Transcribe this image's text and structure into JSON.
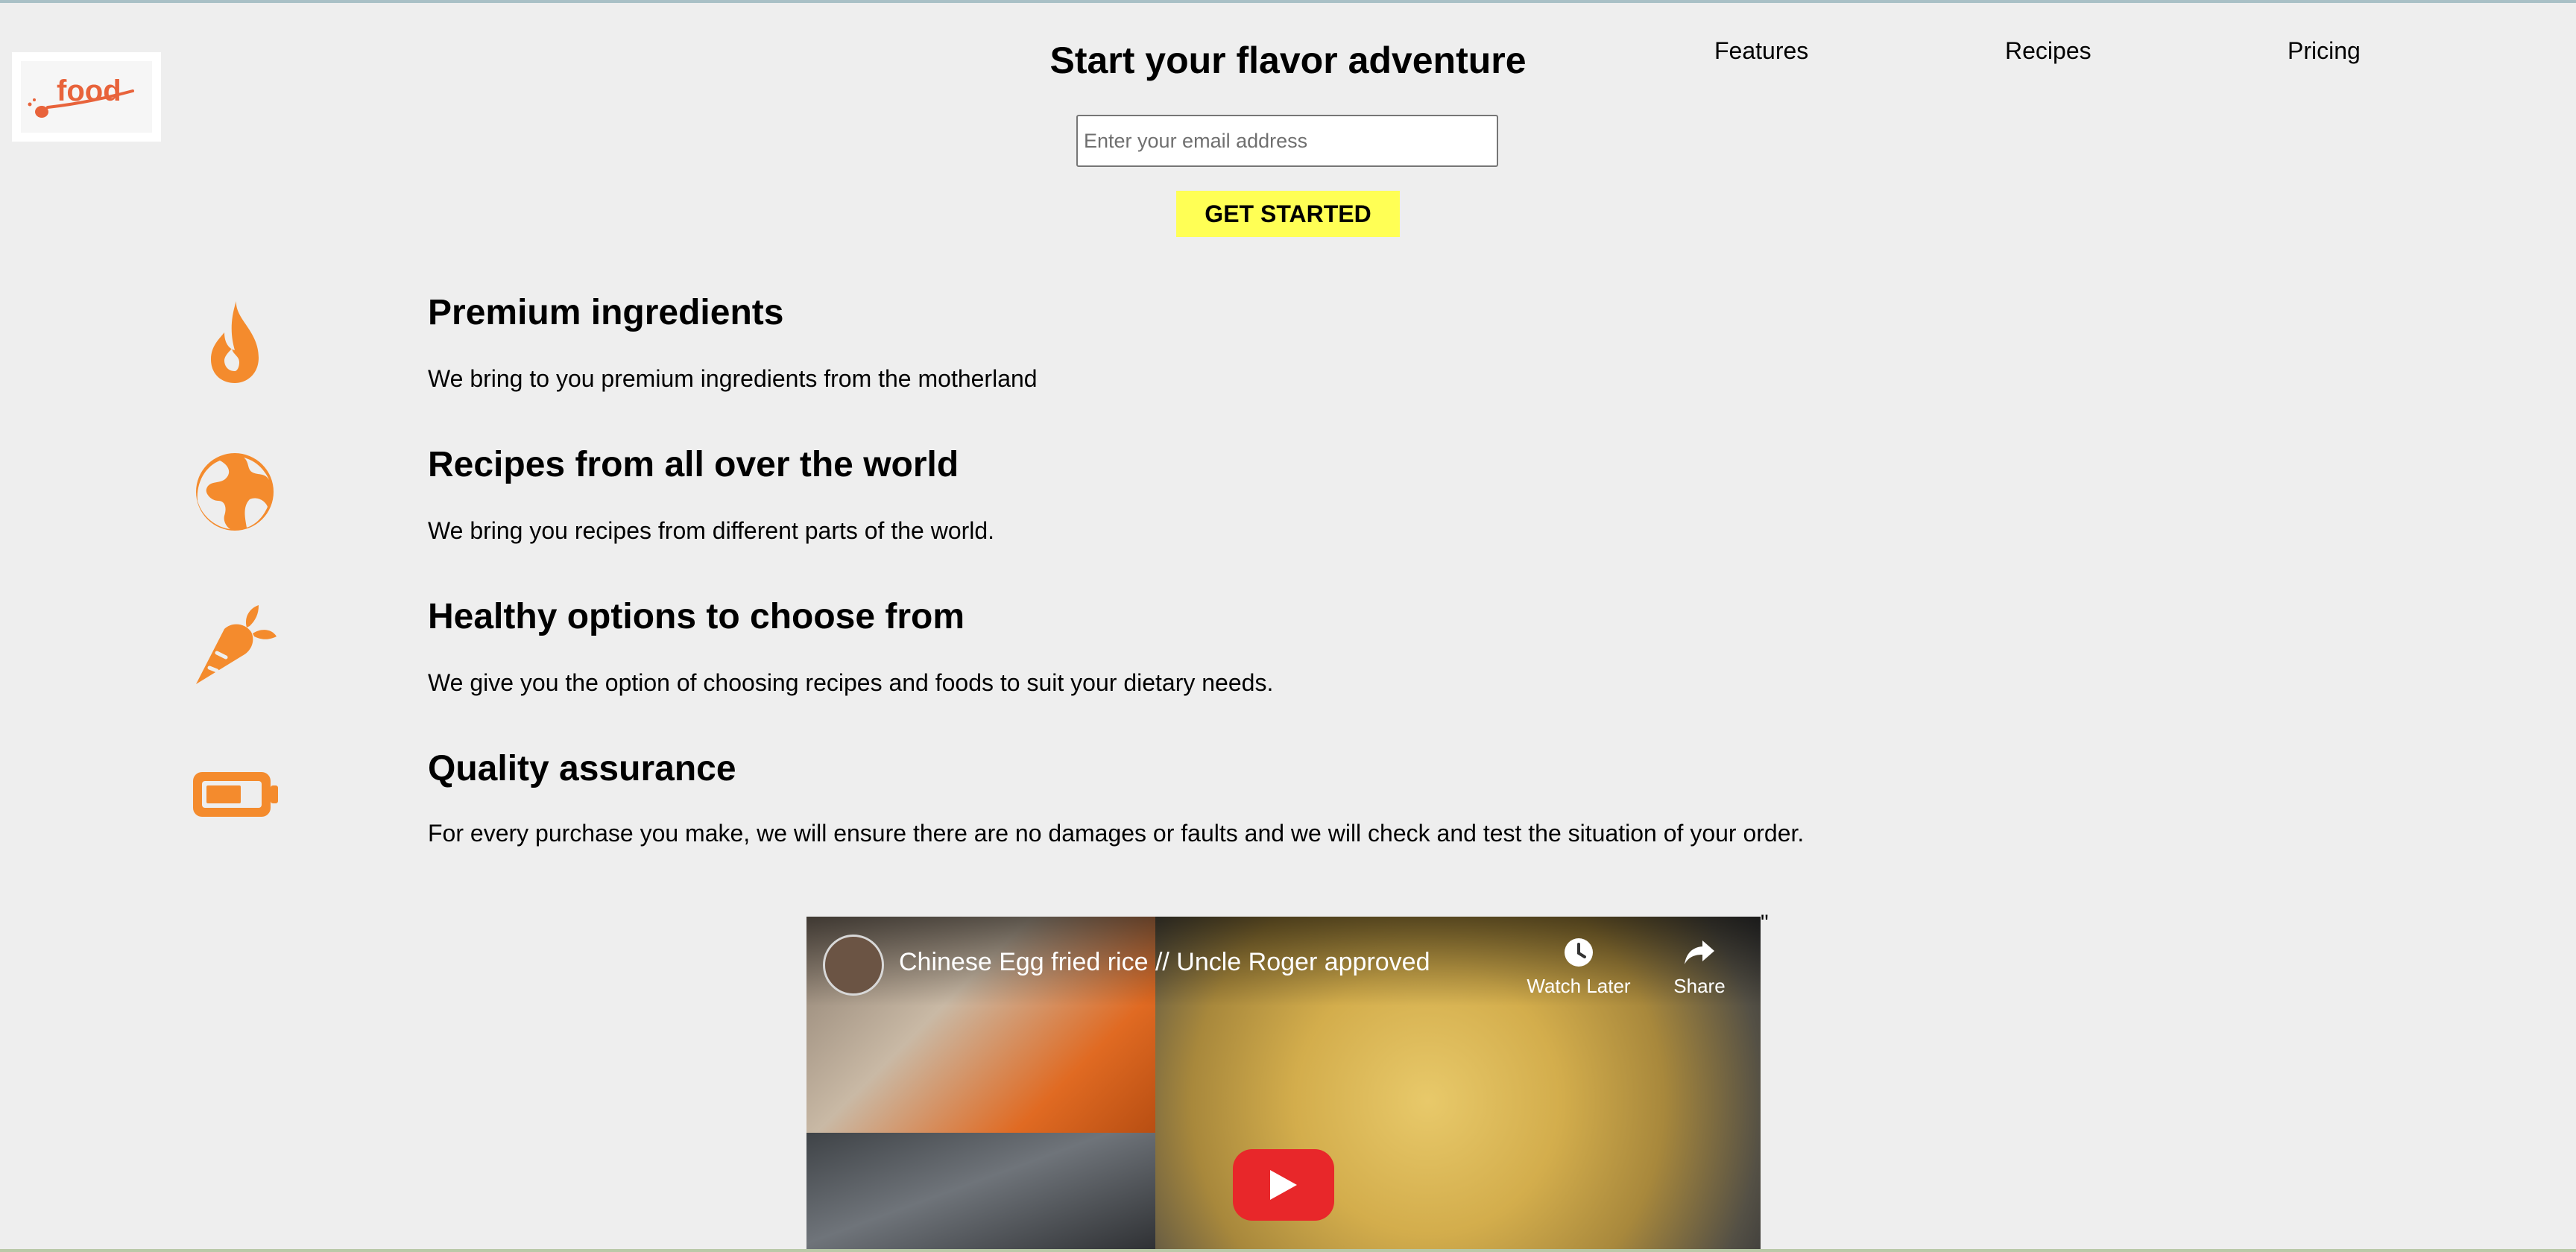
{
  "logo": {
    "text": "food",
    "icon": "food-logo"
  },
  "hero": {
    "title": "Start your flavor adventure",
    "email_placeholder": "Enter your email address",
    "cta_label": "GET STARTED"
  },
  "nav": {
    "items": [
      {
        "label": "Features"
      },
      {
        "label": "Recipes"
      },
      {
        "label": "Pricing"
      }
    ]
  },
  "features": [
    {
      "icon": "fire-icon",
      "title": "Premium ingredients",
      "description": "We bring to you premium ingredients from the motherland"
    },
    {
      "icon": "globe-icon",
      "title": "Recipes from all over the world",
      "description": "We bring you recipes from different parts of the world."
    },
    {
      "icon": "carrot-icon",
      "title": "Healthy options to choose from",
      "description": "We give you the option of choosing recipes and foods to suit your dietary needs."
    },
    {
      "icon": "battery-icon",
      "title": "Quality assurance",
      "description": "For every purchase you make, we will ensure there are no damages or faults and we will check and test the situation of your order."
    }
  ],
  "video": {
    "title": "Chinese Egg fried rice // Uncle Roger approved",
    "watch_later_label": "Watch Later",
    "share_label": "Share",
    "trailing_text": "\""
  },
  "colors": {
    "background": "#eeeeee",
    "accent_orange": "#f48b2d",
    "cta_yellow": "#ffff55",
    "logo_orange": "#e8633b",
    "play_red": "#e8272a"
  }
}
